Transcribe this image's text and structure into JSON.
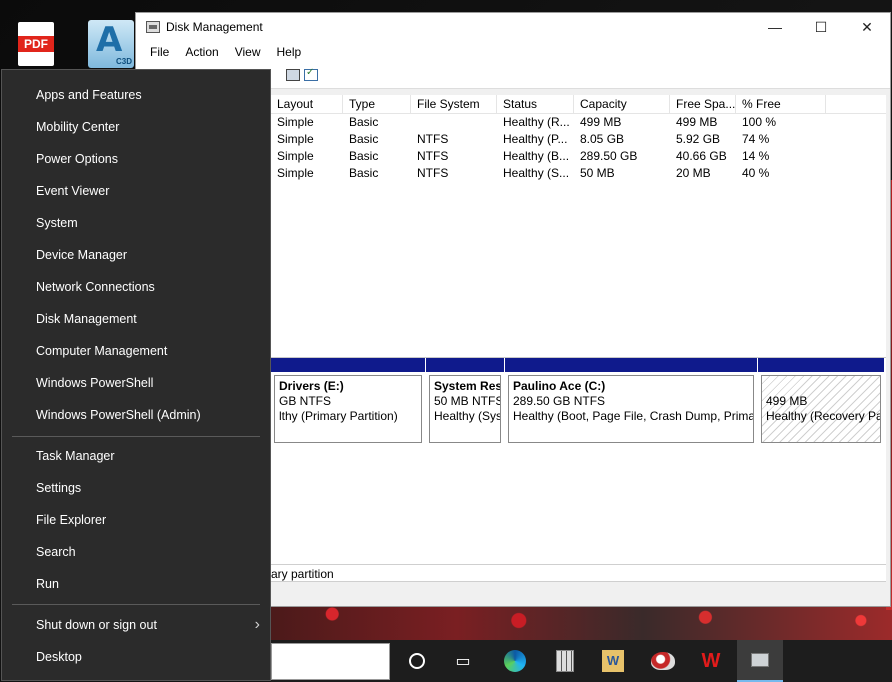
{
  "desktop": {
    "icons": [
      {
        "label": "PDF"
      },
      {
        "label": "A",
        "badge": "C3D"
      }
    ]
  },
  "window": {
    "title": "Disk Management",
    "controls": {
      "minimize": "—",
      "maximize": "☐",
      "close": "✕"
    },
    "menu": [
      "File",
      "Action",
      "View",
      "Help"
    ],
    "volume_columns": [
      "Layout",
      "Type",
      "File System",
      "Status",
      "Capacity",
      "Free Spa...",
      "% Free"
    ],
    "volumes": [
      [
        "Simple",
        "Basic",
        "",
        "Healthy (R...",
        "499 MB",
        "499 MB",
        "100 %"
      ],
      [
        "Simple",
        "Basic",
        "NTFS",
        "Healthy (P...",
        "8.05 GB",
        "5.92 GB",
        "74 %"
      ],
      [
        "Simple",
        "Basic",
        "NTFS",
        "Healthy (B...",
        "289.50 GB",
        "40.66 GB",
        "14 %"
      ],
      [
        "Simple",
        "Basic",
        "NTFS",
        "Healthy (S...",
        "50 MB",
        "20 MB",
        "40 %"
      ]
    ],
    "partitions": [
      {
        "name": "Drivers  (E:)",
        "size": "GB NTFS",
        "status": "lthy (Primary Partition)"
      },
      {
        "name": "System Res",
        "size": "50 MB NTFS",
        "status": "Healthy (Sys"
      },
      {
        "name": "Paulino Ace  (C:)",
        "size": "289.50 GB NTFS",
        "status": "Healthy (Boot, Page File, Crash Dump, Primar"
      },
      {
        "name": "",
        "size": "499 MB",
        "status": "Healthy (Recovery Pa"
      }
    ],
    "legend": "ary partition"
  },
  "winx_menu": {
    "group1": [
      "Apps and Features",
      "Mobility Center",
      "Power Options",
      "Event Viewer",
      "System",
      "Device Manager",
      "Network Connections",
      "Disk Management",
      "Computer Management",
      "Windows PowerShell",
      "Windows PowerShell (Admin)"
    ],
    "group2": [
      "Task Manager",
      "Settings",
      "File Explorer",
      "Search",
      "Run"
    ],
    "group3": [
      "Shut down or sign out",
      "Desktop"
    ],
    "submenu_arrow": "›"
  },
  "taskbar": {
    "word_label": "W"
  }
}
